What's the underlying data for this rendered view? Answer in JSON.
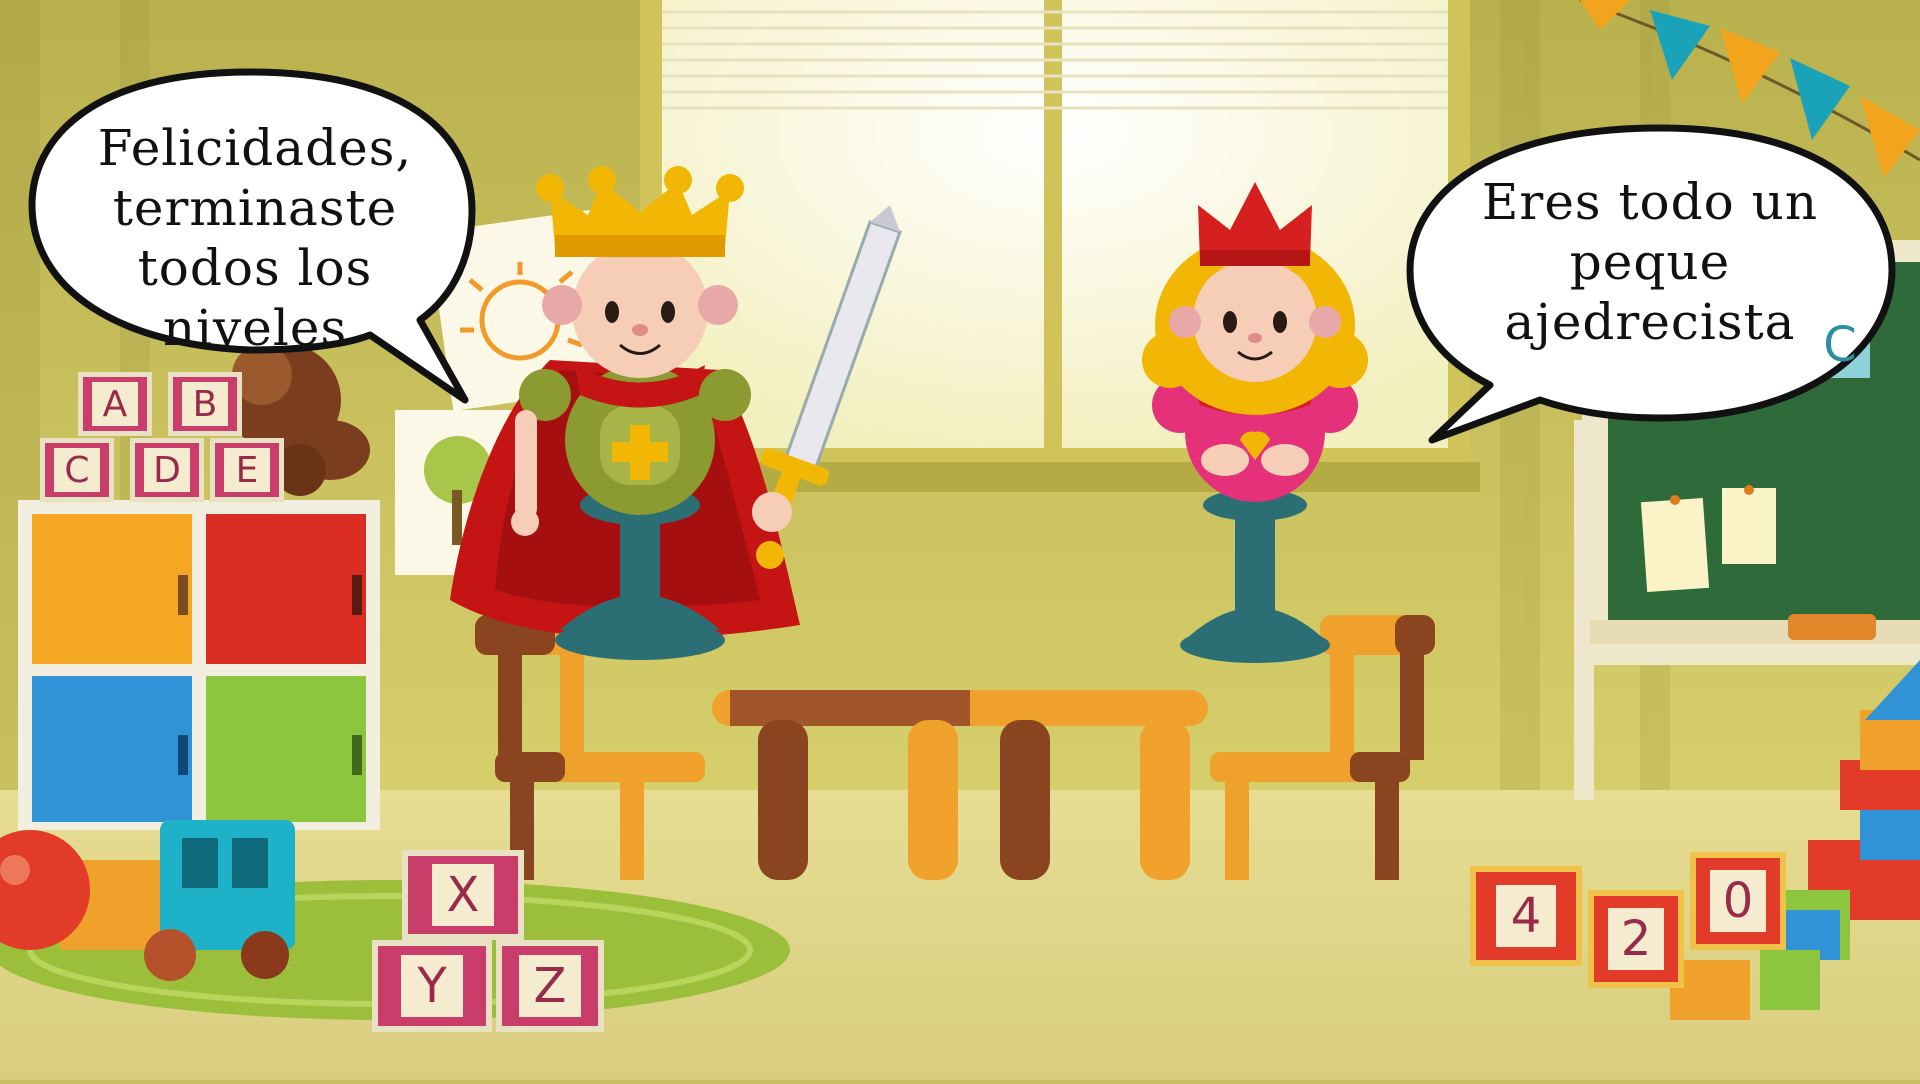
{
  "bubbles": {
    "left": {
      "lines": [
        "Felicidades,",
        "terminaste",
        "todos los",
        "niveles"
      ]
    },
    "right": {
      "lines": [
        "Eres todo un",
        "peque",
        "ajedrecista"
      ]
    }
  },
  "blocks": {
    "shelf_top": [
      "A",
      "B"
    ],
    "shelf_bottom": [
      "C",
      "D",
      "E"
    ],
    "floor_left_top": [
      "X"
    ],
    "floor_left_bottom": [
      "Y",
      "Z"
    ],
    "floor_right": [
      "4",
      "2",
      "0"
    ]
  },
  "chalkboard": {
    "letter": "C"
  },
  "colors": {
    "wall": "#c9c25f",
    "floor": "#e3d98a",
    "rug": "#9bbf3a",
    "king_cape": "#c41414",
    "crown": "#f2b705",
    "queen_dress": "#e4317a",
    "chalkboard": "#2f6b3a",
    "table": "#a0562a",
    "chair": "#f0a12c"
  },
  "characters": [
    "king",
    "queen"
  ]
}
